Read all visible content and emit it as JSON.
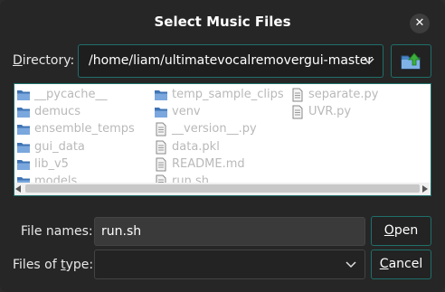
{
  "dialog": {
    "title": "Select Music Files",
    "close_glyph": "✕"
  },
  "directory": {
    "label_first": "D",
    "label_rest": "irectory:",
    "path": "/home/liam/ultimatevocalremovergui-master",
    "up_icon": "folder-up-icon"
  },
  "files": {
    "columns": [
      [
        {
          "name": "__pycache__",
          "type": "folder"
        },
        {
          "name": "demucs",
          "type": "folder"
        },
        {
          "name": "ensemble_temps",
          "type": "folder"
        },
        {
          "name": "gui_data",
          "type": "folder"
        },
        {
          "name": "lib_v5",
          "type": "folder"
        },
        {
          "name": "models",
          "type": "folder"
        }
      ],
      [
        {
          "name": "temp_sample_clips",
          "type": "folder"
        },
        {
          "name": "venv",
          "type": "folder"
        },
        {
          "name": "__version__.py",
          "type": "file"
        },
        {
          "name": "data.pkl",
          "type": "file"
        },
        {
          "name": "README.md",
          "type": "file"
        },
        {
          "name": "run.sh",
          "type": "file"
        }
      ],
      [
        {
          "name": "separate.py",
          "type": "file"
        },
        {
          "name": "UVR.py",
          "type": "file"
        }
      ]
    ]
  },
  "file_names": {
    "label": "File names:",
    "value": "run.sh"
  },
  "files_of_type": {
    "label_a": "Files of ",
    "label_u": "t",
    "label_b": "ype:",
    "value": ""
  },
  "buttons": {
    "open_u": "O",
    "open_rest": "pen",
    "cancel_u": "C",
    "cancel_rest": "ancel"
  },
  "colors": {
    "accent_border": "#1f6f6a",
    "background": "#262626",
    "folder": "#4a7fc1"
  }
}
